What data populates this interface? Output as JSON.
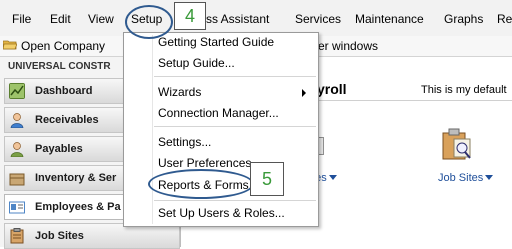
{
  "menubar": {
    "items": [
      {
        "label": "File"
      },
      {
        "label": "Edit"
      },
      {
        "label": "View"
      },
      {
        "label": "Setup"
      },
      {
        "label": "ss Assistant"
      },
      {
        "label": "Services"
      },
      {
        "label": "Maintenance"
      },
      {
        "label": "Graphs"
      },
      {
        "label": "Re"
      }
    ]
  },
  "toolbar": {
    "open_company_label": "Open Company",
    "other_windows_label": "er windows"
  },
  "sidebar": {
    "company_name": "UNIVERSAL CONSTR",
    "items": [
      {
        "label": "Dashboard",
        "icon": "chart-icon",
        "color": "#7aa33f"
      },
      {
        "label": "Receivables",
        "icon": "person-icon",
        "color": "#3f7fcf"
      },
      {
        "label": "Payables",
        "icon": "person-icon",
        "color": "#7a9f45"
      },
      {
        "label": "Inventory & Ser",
        "icon": "box-icon",
        "color": "#b89a63"
      },
      {
        "label": "Employees & Pa",
        "icon": "id-card-icon",
        "color": "#4f86c6"
      },
      {
        "label": "Job Sites",
        "icon": "clipboard-icon",
        "color": "#b97c3a"
      }
    ]
  },
  "content": {
    "title": "yroll",
    "note": "This is my default",
    "link_left": "ees",
    "link_right": "Job Sites"
  },
  "setup_menu": {
    "items": [
      {
        "label": "Getting Started Guide"
      },
      {
        "label": "Setup Guide..."
      },
      {
        "label": "Wizards"
      },
      {
        "label": "Connection Manager..."
      },
      {
        "label": "Settings..."
      },
      {
        "label": "User Preferences..."
      },
      {
        "label": "Reports & Forms..."
      },
      {
        "label": "Set Up Users & Roles..."
      }
    ]
  },
  "annotations": {
    "step_setup": "4",
    "step_reports": "5"
  },
  "colors": {
    "annotation_stroke": "#2f5a8f",
    "step_number": "#3a9a3a",
    "link_blue": "#1f4f9a"
  }
}
